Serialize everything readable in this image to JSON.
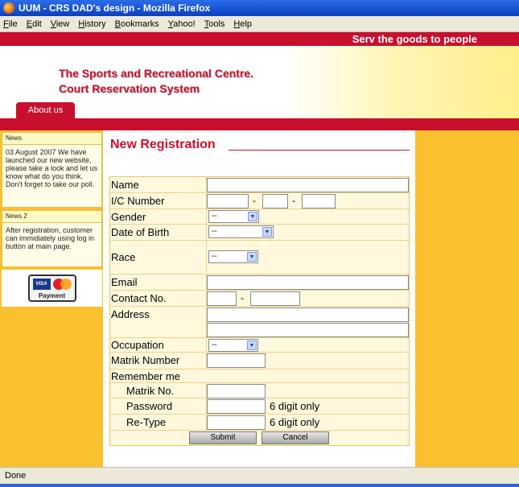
{
  "window": {
    "title": "UUM - CRS DAD's design - Mozilla Firefox"
  },
  "menu": [
    "File",
    "Edit",
    "View",
    "History",
    "Bookmarks",
    "Yahoo!",
    "Tools",
    "Help"
  ],
  "site": {
    "slogan": "Serv the goods to people",
    "title_line1": "The Sports and Recreational Centre.",
    "title_line2": "Court Reservation System",
    "tab_about": "About us"
  },
  "sidebar": {
    "news_title": "News",
    "news_body": "03 August 2007 We have launched our new website, please take a look and let us know what do you think. Don't forget to take our poll.",
    "news2_title": "News 2",
    "news2_body": "After registration, customer can immidiately using log in button at main page.",
    "payment_label": "Payment",
    "visa_text": "VISA"
  },
  "form": {
    "title": "New Registration",
    "name_label": "Name",
    "ic_label": "I/C Number",
    "ic_dash": "-",
    "gender_label": "Gender",
    "gender_value": "--",
    "dob_label": "Date of Birth",
    "dob_value": "--",
    "race_label": "Race",
    "race_value": "--",
    "email_label": "Email",
    "contact_label": "Contact No.",
    "contact_dash": "-",
    "address_label": "Address",
    "occupation_label": "Occupation",
    "occupation_value": "--",
    "matrik_label": "Matrik Number",
    "remember_label": "Remember me",
    "matrik_no_label": "Matrik No.",
    "password_label": "Password",
    "password_note": "6 digit only",
    "retype_label": "Re-Type",
    "retype_note": "6 digit only",
    "submit_label": "Submit",
    "cancel_label": "Cancel"
  },
  "status": {
    "text": "Done"
  }
}
